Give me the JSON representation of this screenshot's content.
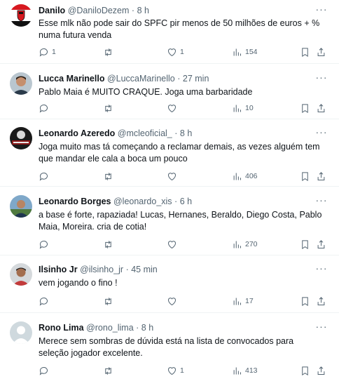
{
  "tweets": [
    {
      "name": "Danilo",
      "handle": "@DaniloDezem",
      "time": "8 h",
      "text": "Esse mlk não pode sair do SPFC pir menos de 50 milhões de euros + % numa futura venda",
      "replies": "1",
      "retweets": "",
      "likes": "1",
      "views": "154"
    },
    {
      "name": "Lucca Marinello",
      "handle": "@LuccaMarinello",
      "time": "27 min",
      "text": "Pablo Maia é MUITO CRAQUE. Joga uma barbaridade",
      "replies": "",
      "retweets": "",
      "likes": "",
      "views": "10"
    },
    {
      "name": "Leonardo Azeredo",
      "handle": "@mcleoficial_",
      "time": "8 h",
      "text": "Joga muito mas tá começando a reclamar demais, as vezes alguém tem que mandar ele cala a boca um pouco",
      "replies": "",
      "retweets": "",
      "likes": "",
      "views": "406"
    },
    {
      "name": "Leonardo Borges",
      "handle": "@leonardo_xis",
      "time": "6 h",
      "text": "a base é forte, rapaziada! Lucas, Hernanes, Beraldo, Diego Costa, Pablo Maia, Moreira. cria de cotia!",
      "replies": "",
      "retweets": "",
      "likes": "",
      "views": "270"
    },
    {
      "name": "Ilsinho Jr",
      "handle": "@ilsinho_jr",
      "time": "45 min",
      "text": "vem jogando o fino !",
      "replies": "",
      "retweets": "",
      "likes": "",
      "views": "17"
    },
    {
      "name": "Rono Lima",
      "handle": "@rono_lima",
      "time": "8 h",
      "text": "Merece sem sombras de dúvida está na lista de convocados para seleção jogador excelente.",
      "replies": "",
      "retweets": "",
      "likes": "1",
      "views": "413"
    }
  ],
  "icons": {
    "more": "more-horizontal-icon",
    "reply": "reply-icon",
    "retweet": "retweet-icon",
    "like": "heart-icon",
    "views": "views-chart-icon",
    "bookmark": "bookmark-icon",
    "share": "share-icon"
  },
  "colors": {
    "text": "#0f1419",
    "muted": "#536471",
    "divider": "#eff3f4"
  }
}
